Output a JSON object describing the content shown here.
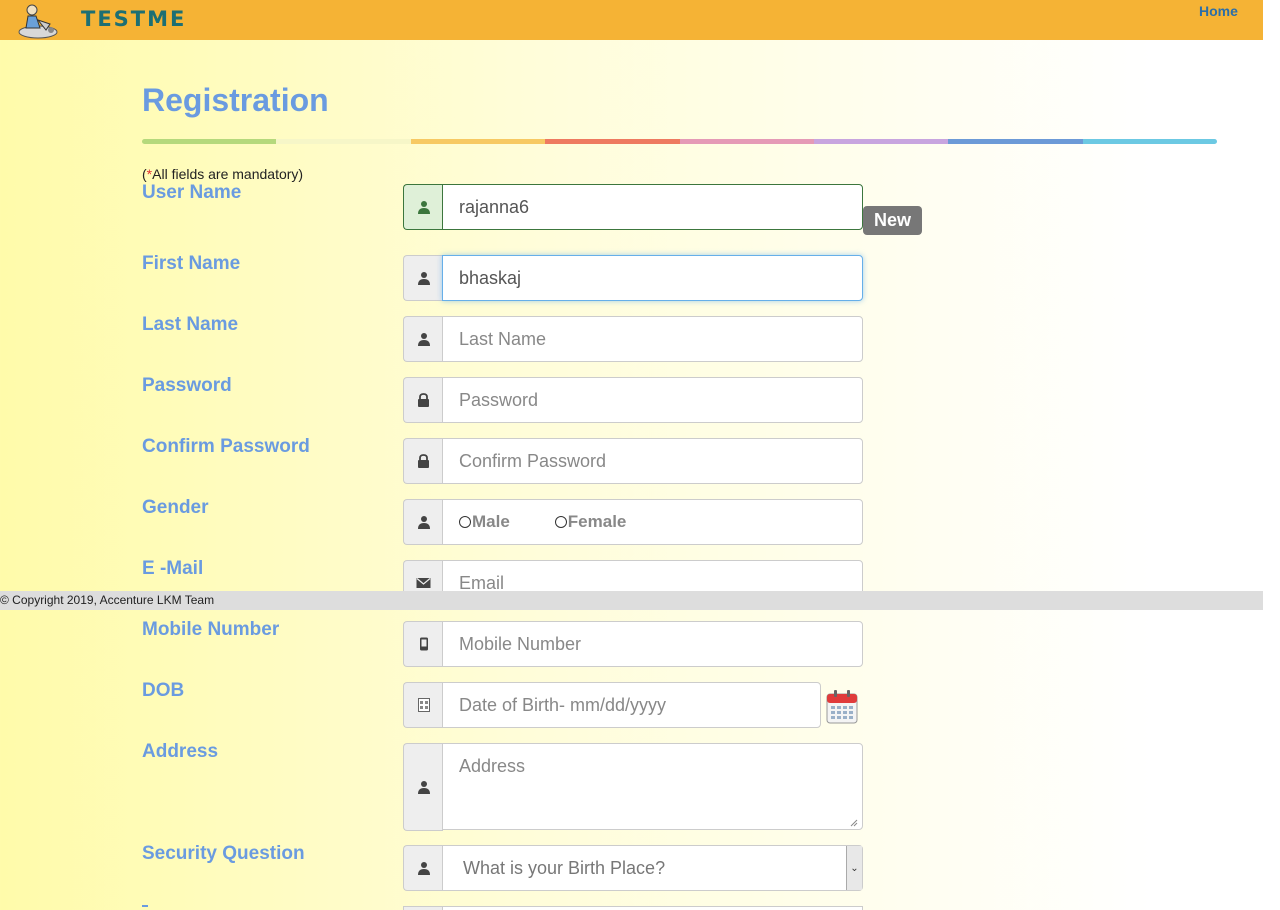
{
  "header": {
    "logo_text": "TESTME",
    "home_link": "Home"
  },
  "page": {
    "title": "Registration",
    "mandatory_note": "All fields are mandatory)",
    "mandatory_open": "(",
    "mandatory_star": "*"
  },
  "colorbar": [
    "#b5d97c",
    "#f6f6c8",
    "#f7c963",
    "#ee7a60",
    "#e59ab6",
    "#c8a5df",
    "#6c9ad7",
    "#6cc9e3"
  ],
  "fields": {
    "username": {
      "label": "User Name",
      "value": "rajanna6",
      "placeholder": "User Name",
      "icon": "user-icon",
      "badge": "New"
    },
    "firstname": {
      "label": "First Name",
      "value": "bhaskaj",
      "placeholder": "First Name",
      "icon": "user-icon"
    },
    "lastname": {
      "label": "Last Name",
      "value": "",
      "placeholder": "Last Name",
      "icon": "user-icon"
    },
    "password": {
      "label": "Password",
      "value": "",
      "placeholder": "Password",
      "icon": "lock-icon"
    },
    "confirm": {
      "label": "Confirm Password",
      "value": "",
      "placeholder": "Confirm Password",
      "icon": "lock-icon"
    },
    "gender": {
      "label": "Gender",
      "options": [
        "Male",
        "Female"
      ],
      "icon": "user-icon"
    },
    "email": {
      "label": "E -Mail",
      "value": "",
      "placeholder": "Email",
      "icon": "envelope-icon"
    },
    "mobile": {
      "label": "Mobile Number",
      "value": "",
      "placeholder": "Mobile Number",
      "icon": "phone-icon"
    },
    "dob": {
      "label": "DOB",
      "value": "",
      "placeholder": "Date of Birth- mm/dd/yyyy",
      "icon": "calendar-small-icon"
    },
    "address": {
      "label": "Address",
      "value": "",
      "placeholder": "Address",
      "icon": "user-icon"
    },
    "security": {
      "label": "Security Question",
      "selected": "What is your Birth Place?",
      "icon": "user-icon"
    }
  },
  "footer": {
    "text": "© Copyright 2019, Accenture LKM Team"
  },
  "colors": {
    "label": "#6a9be0",
    "topbar": "#f5b335",
    "success": "#3c763d"
  }
}
